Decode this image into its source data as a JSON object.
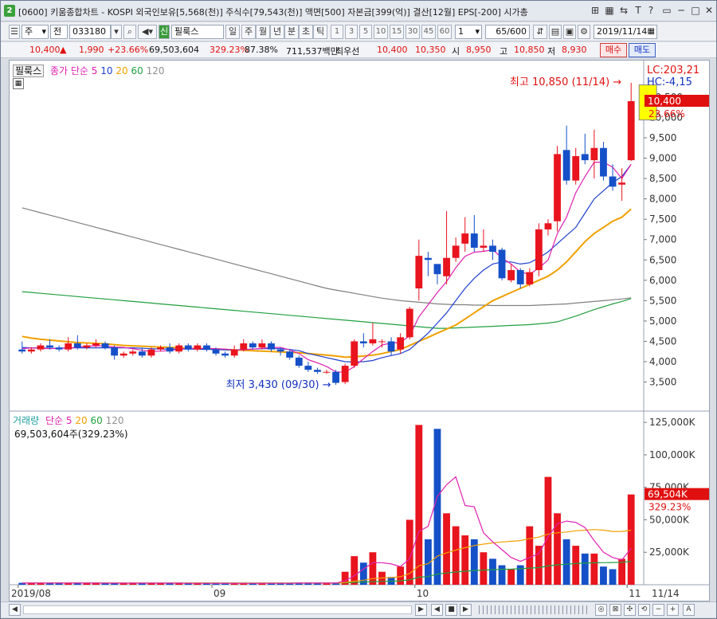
{
  "window": {
    "icon": "2",
    "title": "[0600] 키움종합차트 - KOSPI 외국인보유[5,568(천)] 주식수[79,543(천)] 액면[500] 자본금[399(억)] 결산[12월] EPS[-200] 시가총액",
    "ctrl_icons": [
      "T",
      "?"
    ]
  },
  "toolbar": {
    "period": "주",
    "prev": "전",
    "code": "033180",
    "name": "필룩스",
    "name_badge": "신",
    "tabs": [
      "일",
      "주",
      "월",
      "년",
      "분",
      "초",
      "틱"
    ],
    "selected_tab": "일",
    "nums": [
      "1",
      "3",
      "5",
      "10",
      "15",
      "30",
      "45",
      "60"
    ],
    "n_value": "1",
    "count": "65/600",
    "date": "2019/11/14"
  },
  "info": {
    "price": "10,400",
    "change": "1,990",
    "change_pct": "+23.66%",
    "volume": "69,503,604",
    "vol_pct": "329.23%",
    "strength": "87.38%",
    "amount": "711,537백만",
    "best_label": "최우선",
    "ask": "10,400",
    "bid": "10,350",
    "open_label": "시",
    "open": "8,950",
    "high_label": "고",
    "high": "10,850",
    "low_label": "저",
    "low": "8,930",
    "buy": "매수",
    "sell": "매도"
  },
  "legend_price": {
    "name": "필룩스",
    "label": "종가 단순",
    "ma": [
      "5",
      "10",
      "20",
      "60",
      "120"
    ]
  },
  "legend_vol": {
    "name": "거래량",
    "label": "단순",
    "ma": [
      "5",
      "20",
      "60",
      "120"
    ],
    "value": "69,503,604주(329.23%)"
  },
  "annotations": {
    "high": "최고 10,850 (11/14) →",
    "low": "최저 3,430 (09/30) →"
  },
  "right_axis": {
    "lc": "LC:203,21",
    "hc": "HC:-4,15",
    "price_badge": "10,400",
    "price_pct": "23.66%",
    "vol_badge": "69,504K",
    "vol_pct": "329.23%",
    "price_ticks": [
      "10,500",
      "10,000",
      "9,500",
      "9,000",
      "8,500",
      "8,000",
      "7,500",
      "7,000",
      "6,500",
      "6,000",
      "5,500",
      "5,000",
      "4,500",
      "4,000",
      "3,500"
    ],
    "vol_ticks": [
      "125,000K",
      "100,000K",
      "75,000K",
      "50,000K",
      "25,000K"
    ]
  },
  "x_axis": {
    "labels": [
      "2019/08",
      "09",
      "10",
      "11",
      "11/14"
    ]
  },
  "colors": {
    "up": "#e8141e",
    "down": "#1550c8",
    "ma5": "#e020b0",
    "ma10": "#2040d0",
    "ma20": "#f0a000",
    "ma60": "#20a040",
    "ma120": "#808080",
    "badge": "#e01010"
  },
  "chart_data": {
    "type": "candlestick",
    "dates_start": "2019/08",
    "series": "price",
    "candles": [
      [
        4300,
        4250,
        4500,
        4200
      ],
      [
        4250,
        4300,
        4350,
        4200
      ],
      [
        4300,
        4400,
        4450,
        4250
      ],
      [
        4400,
        4350,
        4550,
        4300
      ],
      [
        4350,
        4300,
        4400,
        4250
      ],
      [
        4300,
        4450,
        4600,
        4250
      ],
      [
        4450,
        4350,
        4650,
        4300
      ],
      [
        4350,
        4400,
        4450,
        4300
      ],
      [
        4400,
        4450,
        4550,
        4350
      ],
      [
        4450,
        4350,
        4500,
        4300
      ],
      [
        4350,
        4150,
        4400,
        4050
      ],
      [
        4150,
        4200,
        4250,
        4100
      ],
      [
        4200,
        4250,
        4300,
        4150
      ],
      [
        4250,
        4150,
        4350,
        4100
      ],
      [
        4150,
        4300,
        4350,
        4100
      ],
      [
        4300,
        4350,
        4400,
        4250
      ],
      [
        4350,
        4250,
        4450,
        4200
      ],
      [
        4250,
        4400,
        4450,
        4200
      ],
      [
        4400,
        4300,
        4450,
        4250
      ],
      [
        4300,
        4400,
        4450,
        4250
      ],
      [
        4400,
        4300,
        4450,
        4250
      ],
      [
        4300,
        4200,
        4350,
        4150
      ],
      [
        4200,
        4150,
        4250,
        4100
      ],
      [
        4150,
        4300,
        4400,
        4100
      ],
      [
        4300,
        4450,
        4550,
        4250
      ],
      [
        4450,
        4350,
        4500,
        4300
      ],
      [
        4350,
        4450,
        4550,
        4300
      ],
      [
        4450,
        4300,
        4500,
        4250
      ],
      [
        4300,
        4250,
        4350,
        4150
      ],
      [
        4250,
        4100,
        4300,
        4050
      ],
      [
        4100,
        3900,
        4150,
        3850
      ],
      [
        3900,
        3800,
        4000,
        3750
      ],
      [
        3800,
        3750,
        3850,
        3700
      ],
      [
        3750,
        3750,
        3800,
        3700
      ],
      [
        3750,
        3480,
        3800,
        3430
      ],
      [
        3500,
        3900,
        3950,
        3450
      ],
      [
        3900,
        4500,
        4550,
        3850
      ],
      [
        4500,
        4450,
        4700,
        4350
      ],
      [
        4450,
        4550,
        4950,
        4400
      ],
      [
        4500,
        4500,
        4550,
        4350
      ],
      [
        4500,
        4250,
        4600,
        4150
      ],
      [
        4300,
        4600,
        4700,
        4200
      ],
      [
        4600,
        5300,
        5350,
        4550
      ],
      [
        5800,
        6600,
        7000,
        5500
      ],
      [
        6550,
        6500,
        6700,
        6100
      ],
      [
        6400,
        6150,
        6400,
        5900
      ],
      [
        6100,
        6550,
        7700,
        5900
      ],
      [
        6550,
        6850,
        7050,
        6450
      ],
      [
        6900,
        7150,
        7550,
        6700
      ],
      [
        7150,
        6800,
        7600,
        6700
      ],
      [
        6800,
        6850,
        7250,
        6700
      ],
      [
        6850,
        6700,
        7000,
        6500
      ],
      [
        6750,
        6050,
        6800,
        6000
      ],
      [
        6000,
        6250,
        6400,
        5950
      ],
      [
        6250,
        5900,
        6300,
        5800
      ],
      [
        5900,
        6200,
        6300,
        5850
      ],
      [
        6250,
        7250,
        7400,
        6100
      ],
      [
        7250,
        7400,
        7500,
        7100
      ],
      [
        7450,
        9100,
        9300,
        7200
      ],
      [
        9200,
        8450,
        9800,
        8350
      ],
      [
        8450,
        9050,
        9250,
        8350
      ],
      [
        9100,
        8950,
        9600,
        8850
      ],
      [
        8950,
        9250,
        9700,
        8500
      ],
      [
        9250,
        8550,
        9400,
        8450
      ],
      [
        8550,
        8300,
        8850,
        8200
      ],
      [
        8350,
        8400,
        8750,
        7950
      ],
      [
        8950,
        10400,
        10850,
        8930
      ]
    ],
    "volume": [
      1.5,
      1.5,
      1.2,
      1.3,
      1.1,
      1.5,
      1.7,
      1.2,
      1,
      1.1,
      1.4,
      1.2,
      1,
      1.1,
      1.3,
      1.1,
      1,
      1.1,
      1.2,
      1.1,
      1,
      1.1,
      1.2,
      1.1,
      1.3,
      1.2,
      1,
      1.2,
      1.1,
      1,
      1.5,
      1.6,
      1.3,
      1,
      1.2,
      10,
      22,
      17,
      25,
      10,
      6,
      14,
      50,
      123,
      35,
      120,
      55,
      45,
      38,
      35,
      25,
      20,
      15,
      12,
      15,
      45,
      30,
      83,
      55,
      35,
      30,
      24,
      24,
      14,
      12,
      20,
      69.5
    ],
    "ma5": [
      4320,
      4340,
      4330,
      4320,
      4330,
      4330,
      4360,
      4380,
      4390,
      4390,
      4360,
      4350,
      4320,
      4280,
      4250,
      4260,
      4270,
      4310,
      4330,
      4320,
      4330,
      4320,
      4310,
      4290,
      4290,
      4310,
      4330,
      4350,
      4350,
      4290,
      4200,
      4050,
      3970,
      3880,
      3750,
      3740,
      3880,
      4070,
      4250,
      4410,
      4460,
      4470,
      4640,
      5100,
      5400,
      5700,
      5970,
      6310,
      6590,
      6690,
      6710,
      6750,
      6550,
      6400,
      6200,
      6150,
      6300,
      6500,
      7150,
      7550,
      8150,
      8550,
      8900,
      8900,
      8780,
      8500,
      8850
    ],
    "ma10": [
      4350,
      4340,
      4340,
      4330,
      4330,
      4340,
      4340,
      4340,
      4340,
      4340,
      4340,
      4340,
      4340,
      4330,
      4320,
      4310,
      4310,
      4310,
      4310,
      4310,
      4300,
      4300,
      4290,
      4290,
      4300,
      4310,
      4320,
      4320,
      4320,
      4300,
      4270,
      4200,
      4150,
      4100,
      4050,
      4000,
      3990,
      4000,
      4030,
      4100,
      4150,
      4200,
      4300,
      4500,
      4700,
      4950,
      5200,
      5500,
      5800,
      6050,
      6250,
      6400,
      6450,
      6450,
      6400,
      6430,
      6550,
      6700,
      6900,
      7100,
      7300,
      7650,
      8000,
      8200,
      8400,
      8550,
      8850
    ],
    "ma20": [
      4620,
      4580,
      4550,
      4530,
      4510,
      4490,
      4470,
      4460,
      4450,
      4440,
      4420,
      4400,
      4390,
      4380,
      4370,
      4360,
      4350,
      4340,
      4330,
      4320,
      4320,
      4310,
      4300,
      4290,
      4280,
      4270,
      4260,
      4250,
      4240,
      4230,
      4220,
      4200,
      4180,
      4160,
      4140,
      4110,
      4120,
      4140,
      4160,
      4200,
      4250,
      4300,
      4400,
      4500,
      4600,
      4700,
      4800,
      4900,
      5050,
      5200,
      5350,
      5500,
      5600,
      5700,
      5800,
      5900,
      6000,
      6100,
      6250,
      6450,
      6700,
      6950,
      7150,
      7300,
      7450,
      7550,
      7750
    ],
    "ma60": [
      5720,
      5700,
      5680,
      5660,
      5640,
      5620,
      5600,
      5580,
      5560,
      5540,
      5520,
      5500,
      5480,
      5460,
      5440,
      5420,
      5400,
      5380,
      5360,
      5340,
      5320,
      5300,
      5280,
      5260,
      5240,
      5220,
      5200,
      5180,
      5160,
      5140,
      5120,
      5100,
      5080,
      5060,
      5040,
      5020,
      5000,
      4980,
      4960,
      4940,
      4920,
      4900,
      4880,
      4860,
      4840,
      4820,
      4820,
      4830,
      4840,
      4850,
      4860,
      4870,
      4880,
      4890,
      4900,
      4910,
      4930,
      4950,
      4980,
      5050,
      5120,
      5200,
      5280,
      5350,
      5420,
      5480,
      5550
    ],
    "ma120": [
      7780,
      7720,
      7660,
      7600,
      7540,
      7480,
      7420,
      7360,
      7300,
      7240,
      7180,
      7120,
      7060,
      7000,
      6940,
      6880,
      6820,
      6760,
      6700,
      6640,
      6580,
      6520,
      6460,
      6400,
      6340,
      6280,
      6220,
      6160,
      6100,
      6040,
      5980,
      5920,
      5860,
      5800,
      5760,
      5720,
      5680,
      5640,
      5600,
      5560,
      5530,
      5500,
      5480,
      5460,
      5440,
      5420,
      5410,
      5400,
      5400,
      5390,
      5390,
      5380,
      5380,
      5380,
      5380,
      5380,
      5390,
      5400,
      5410,
      5420,
      5440,
      5460,
      5480,
      5500,
      5520,
      5540,
      5570
    ],
    "vol_ma5": [
      1.3,
      1.3,
      1.3,
      1.3,
      1.3,
      1.3,
      1.3,
      1.3,
      1.3,
      1.2,
      1.2,
      1.2,
      1.2,
      1.2,
      1.2,
      1.2,
      1.2,
      1.2,
      1.1,
      1.1,
      1.1,
      1.1,
      1.1,
      1.1,
      1.1,
      1.1,
      1.1,
      1.1,
      1.1,
      1.1,
      1.3,
      1.3,
      1.3,
      1.3,
      1.3,
      3,
      7,
      12,
      17,
      17,
      16,
      14,
      20,
      41,
      45,
      68,
      77,
      83,
      61,
      60,
      40,
      33,
      27,
      21,
      18,
      21,
      24,
      37,
      47,
      49,
      48,
      44,
      34,
      25,
      21,
      19,
      28
    ],
    "vol_ma20": [
      1.3,
      1.3,
      1.3,
      1.3,
      1.3,
      1.3,
      1.3,
      1.3,
      1.3,
      1.3,
      1.3,
      1.3,
      1.3,
      1.3,
      1.3,
      1.3,
      1.3,
      1.3,
      1.3,
      1.3,
      1.3,
      1.2,
      1.2,
      1.2,
      1.2,
      1.2,
      1.2,
      1.2,
      1.2,
      1.2,
      1.2,
      1.2,
      1.2,
      1.2,
      1.2,
      1.7,
      2.7,
      3.5,
      4.7,
      5.2,
      5.5,
      6.2,
      8.6,
      14.6,
      16.2,
      22,
      24.6,
      26.7,
      28.5,
      30.2,
      31.3,
      32.2,
      32.9,
      33.4,
      34,
      35.5,
      36.7,
      39,
      40,
      40.6,
      41.5,
      42,
      42.5,
      42,
      41,
      41,
      42
    ],
    "vol_ma60": [
      1.3,
      1.3,
      1.3,
      1.3,
      1.3,
      1.3,
      1.3,
      1.3,
      1.3,
      1.3,
      1.3,
      1.3,
      1.3,
      1.3,
      1.3,
      1.3,
      1.3,
      1.3,
      1.3,
      1.3,
      1.3,
      1.3,
      1.3,
      1.3,
      1.3,
      1.3,
      1.3,
      1.3,
      1.3,
      1.3,
      1.3,
      1.3,
      1.3,
      1.3,
      1.3,
      1.5,
      1.8,
      2,
      2.4,
      2.6,
      2.7,
      3,
      3.8,
      5.8,
      6.3,
      8.2,
      9.1,
      9.8,
      10.4,
      11,
      11.3,
      11.6,
      11.9,
      12,
      12.3,
      12.8,
      13.2,
      14.5,
      15.3,
      15.8,
      16.3,
      16.6,
      16.9,
      17,
      17.1,
      17.3,
      18
    ]
  }
}
